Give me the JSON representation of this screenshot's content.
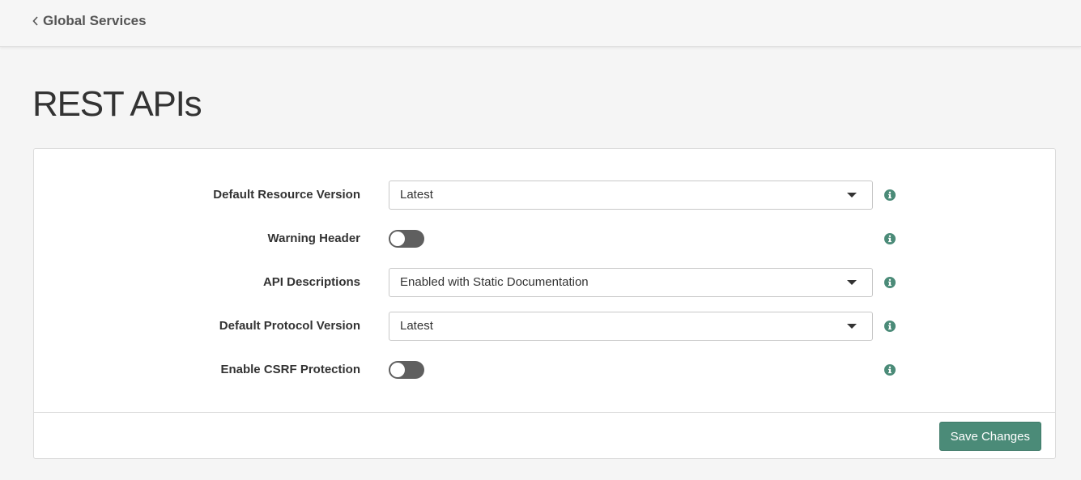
{
  "header": {
    "back_label": "Global Services"
  },
  "page": {
    "title": "REST APIs"
  },
  "form": {
    "default_resource_version": {
      "label": "Default Resource Version",
      "value": "Latest"
    },
    "warning_header": {
      "label": "Warning Header",
      "enabled": false
    },
    "api_descriptions": {
      "label": "API Descriptions",
      "value": "Enabled with Static Documentation"
    },
    "default_protocol_version": {
      "label": "Default Protocol Version",
      "value": "Latest"
    },
    "enable_csrf_protection": {
      "label": "Enable CSRF Protection",
      "enabled": false
    }
  },
  "footer": {
    "save_label": "Save Changes"
  },
  "colors": {
    "accent": "#4b8b78",
    "info_icon": "#4b8b78",
    "toggle_off": "#5f5f5f"
  },
  "icons": {
    "back": "chevron-left-icon",
    "dropdown": "caret-down-icon",
    "info": "info-circle-icon"
  }
}
